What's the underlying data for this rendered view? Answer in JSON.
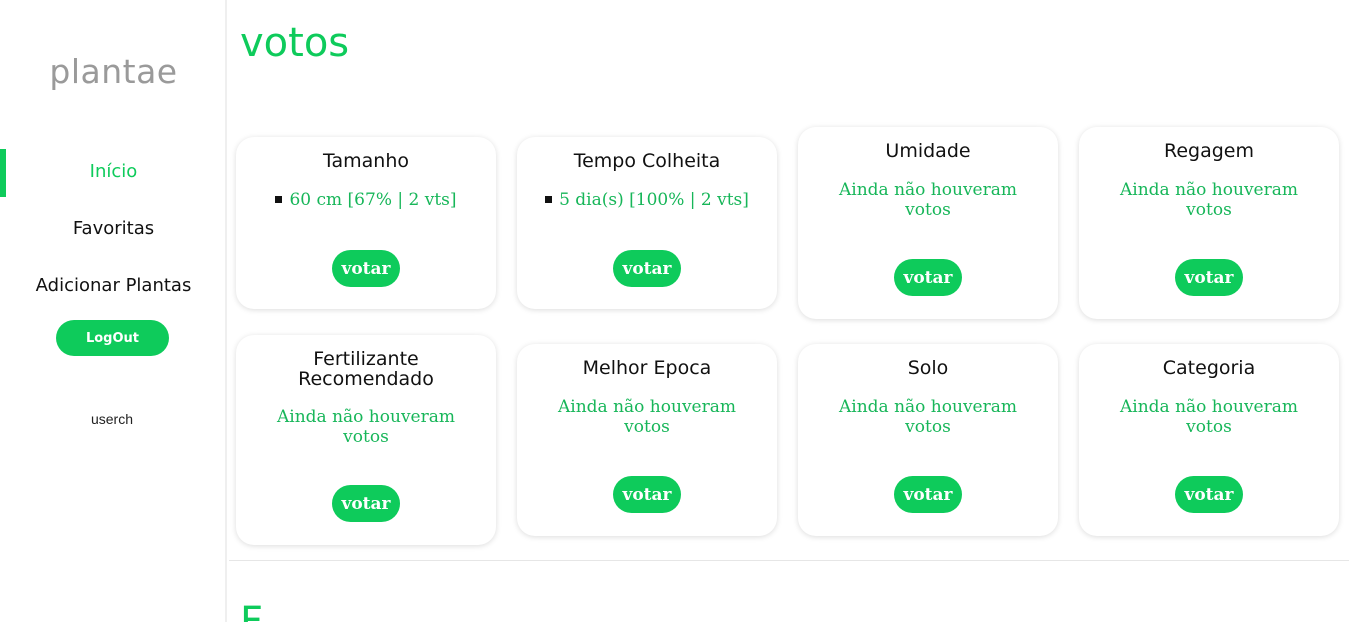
{
  "sidebar": {
    "logo": "plantae",
    "nav": [
      {
        "label": "Início"
      },
      {
        "label": "Favoritas"
      },
      {
        "label": "Adicionar Plantas"
      }
    ],
    "logout_label": "LogOut",
    "username": "userch"
  },
  "main": {
    "title": "votos",
    "vote_label": "votar",
    "cards": [
      {
        "title": "Tamanho",
        "result": "60 cm [67% | 2 vts]"
      },
      {
        "title": "Tempo Colheita",
        "result": "5 dia(s) [100% | 2 vts]"
      },
      {
        "title": "Umidade",
        "result_line1": "Ainda não houveram",
        "result_line2": "votos"
      },
      {
        "title": "Regagem",
        "result_line1": "Ainda não houveram",
        "result_line2": "votos"
      },
      {
        "title_line1": "Fertilizante",
        "title_line2": "Recomendado",
        "result_line1": "Ainda não houveram",
        "result_line2": "votos"
      },
      {
        "title": "Melhor Epoca",
        "result_line1": "Ainda não houveram",
        "result_line2": "votos"
      },
      {
        "title": "Solo",
        "result_line1": "Ainda não houveram",
        "result_line2": "votos"
      },
      {
        "title": "Categoria",
        "result_line1": "Ainda não houveram",
        "result_line2": "votos"
      }
    ],
    "next_section_heading": "F"
  },
  "colors": {
    "accent": "#0ecb5b",
    "result_text": "#17b659",
    "logo": "#9a9a9a"
  }
}
